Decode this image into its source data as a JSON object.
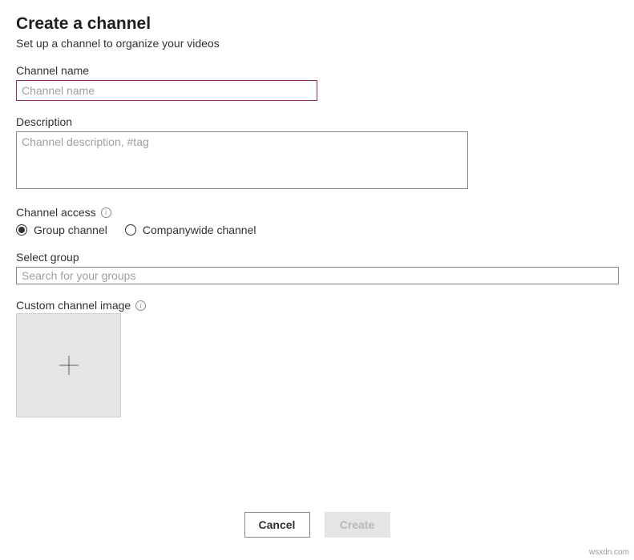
{
  "header": {
    "title": "Create a channel",
    "subtitle": "Set up a channel to organize your videos"
  },
  "fields": {
    "name": {
      "label": "Channel name",
      "placeholder": "Channel name"
    },
    "description": {
      "label": "Description",
      "placeholder": "Channel description, #tag"
    },
    "access": {
      "label": "Channel access",
      "options": {
        "group": "Group channel",
        "company": "Companywide channel"
      }
    },
    "group": {
      "label": "Select group",
      "placeholder": "Search for your groups"
    },
    "image": {
      "label": "Custom channel image"
    }
  },
  "buttons": {
    "cancel": "Cancel",
    "create": "Create"
  },
  "watermark": "wsxdn.com"
}
